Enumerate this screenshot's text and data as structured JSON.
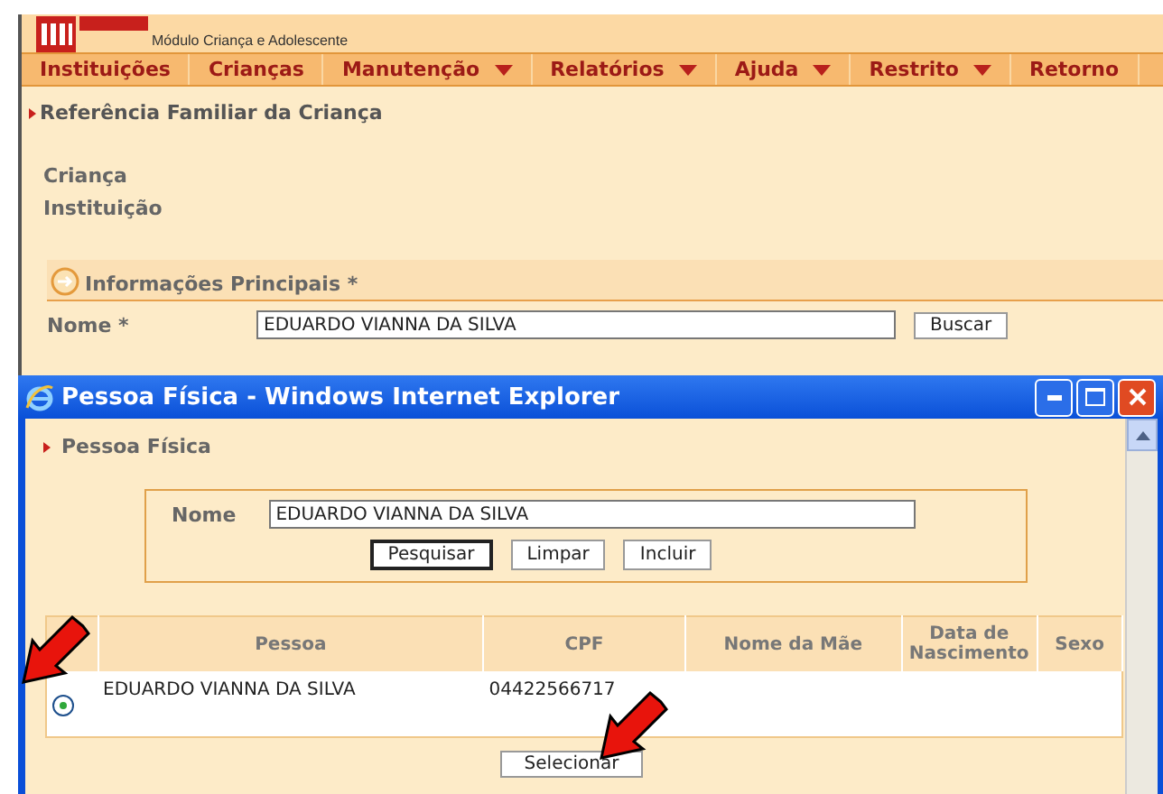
{
  "header": {
    "subtitle": "Módulo Criança e Adolescente"
  },
  "menu": [
    {
      "label": "Instituições",
      "dropdown": false
    },
    {
      "label": "Crianças",
      "dropdown": false
    },
    {
      "label": "Manutenção",
      "dropdown": true
    },
    {
      "label": "Relatórios",
      "dropdown": true
    },
    {
      "label": "Ajuda",
      "dropdown": true
    },
    {
      "label": "Restrito",
      "dropdown": true
    },
    {
      "label": "Retorno",
      "dropdown": false
    }
  ],
  "breadcrumb": "Referência Familiar da Criança",
  "info_labels": [
    "Criança",
    "Instituição"
  ],
  "section": {
    "title": "Informações Principais *",
    "name_label": "Nome *",
    "name_value": "EDUARDO VIANNA DA SILVA",
    "button": "Buscar"
  },
  "popup": {
    "title": "Pessoa Física - Windows Internet Explorer",
    "breadcrumb": "Pessoa Física",
    "name_label": "Nome",
    "name_value": "EDUARDO VIANNA DA SILVA",
    "buttons": [
      {
        "label": "Pesquisar",
        "selected": true
      },
      {
        "label": "Limpar",
        "selected": false
      },
      {
        "label": "Incluir",
        "selected": false
      }
    ],
    "columns": [
      "Pessoa",
      "CPF",
      "Nome da Mãe",
      "Data de Nascimento",
      "Sexo"
    ],
    "rows": [
      {
        "selected": true,
        "cells": [
          "EDUARDO VIANNA DA SILVA",
          "04422566717",
          "",
          "",
          ""
        ]
      }
    ],
    "select_button": "Selecionar"
  }
}
